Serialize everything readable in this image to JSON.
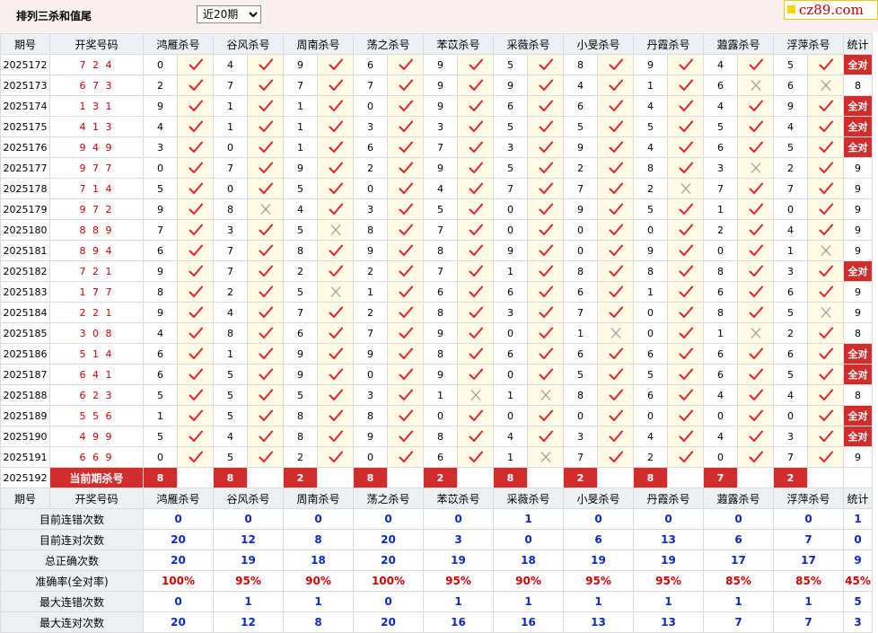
{
  "header": {
    "title": "排列三杀和值尾",
    "period_select": "近20期",
    "logo": "cz89.com"
  },
  "columns": {
    "issue": "期号",
    "code": "开奖号码",
    "stat": "统计",
    "experts": [
      "鸿雁杀号",
      "谷风杀号",
      "周南杀号",
      "荡之杀号",
      "苯苡杀号",
      "采薇杀号",
      "小旻杀号",
      "丹霞杀号",
      "蕸露杀号",
      "浮萍杀号"
    ]
  },
  "rows": [
    {
      "issue": "2025172",
      "code": "7 2 4",
      "vals": [
        "0",
        "4",
        "9",
        "6",
        "9",
        "5",
        "8",
        "9",
        "4",
        "5"
      ],
      "ok": [
        1,
        1,
        1,
        1,
        1,
        1,
        1,
        1,
        1,
        1
      ],
      "stat": "全对"
    },
    {
      "issue": "2025173",
      "code": "6 7 3",
      "vals": [
        "2",
        "7",
        "7",
        "7",
        "9",
        "9",
        "4",
        "1",
        "6",
        "6"
      ],
      "ok": [
        1,
        1,
        1,
        1,
        1,
        1,
        1,
        1,
        0,
        0
      ],
      "stat": "8"
    },
    {
      "issue": "2025174",
      "code": "1 3 1",
      "vals": [
        "9",
        "1",
        "1",
        "0",
        "9",
        "6",
        "6",
        "4",
        "4",
        "9"
      ],
      "ok": [
        1,
        1,
        1,
        1,
        1,
        1,
        1,
        1,
        1,
        1
      ],
      "stat": "全对"
    },
    {
      "issue": "2025175",
      "code": "4 1 3",
      "vals": [
        "4",
        "1",
        "1",
        "3",
        "3",
        "5",
        "5",
        "5",
        "5",
        "4"
      ],
      "ok": [
        1,
        1,
        1,
        1,
        1,
        1,
        1,
        1,
        1,
        1
      ],
      "stat": "全对"
    },
    {
      "issue": "2025176",
      "code": "9 4 9",
      "vals": [
        "3",
        "0",
        "1",
        "6",
        "7",
        "3",
        "9",
        "4",
        "6",
        "5"
      ],
      "ok": [
        1,
        1,
        1,
        1,
        1,
        1,
        1,
        1,
        1,
        1
      ],
      "stat": "全对"
    },
    {
      "issue": "2025177",
      "code": "9 7 7",
      "vals": [
        "0",
        "7",
        "9",
        "2",
        "9",
        "5",
        "2",
        "8",
        "3",
        "2"
      ],
      "ok": [
        1,
        1,
        1,
        1,
        1,
        1,
        1,
        1,
        0,
        1
      ],
      "stat": "9"
    },
    {
      "issue": "2025178",
      "code": "7 1 4",
      "vals": [
        "5",
        "0",
        "5",
        "0",
        "4",
        "7",
        "7",
        "2",
        "7",
        "7"
      ],
      "ok": [
        1,
        1,
        1,
        1,
        1,
        1,
        1,
        0,
        1,
        1
      ],
      "stat": "9"
    },
    {
      "issue": "2025179",
      "code": "9 7 2",
      "vals": [
        "9",
        "8",
        "4",
        "3",
        "5",
        "0",
        "9",
        "5",
        "1",
        "0"
      ],
      "ok": [
        1,
        0,
        1,
        1,
        1,
        1,
        1,
        1,
        1,
        1
      ],
      "stat": "9"
    },
    {
      "issue": "2025180",
      "code": "8 8 9",
      "vals": [
        "7",
        "3",
        "5",
        "8",
        "7",
        "0",
        "0",
        "0",
        "2",
        "4"
      ],
      "ok": [
        1,
        1,
        0,
        1,
        1,
        1,
        1,
        1,
        1,
        1
      ],
      "stat": "9"
    },
    {
      "issue": "2025181",
      "code": "8 9 4",
      "vals": [
        "6",
        "7",
        "8",
        "9",
        "8",
        "9",
        "0",
        "9",
        "0",
        "1"
      ],
      "ok": [
        1,
        1,
        1,
        1,
        1,
        1,
        1,
        1,
        1,
        0
      ],
      "stat": "9"
    },
    {
      "issue": "2025182",
      "code": "7 2 1",
      "vals": [
        "9",
        "7",
        "2",
        "2",
        "7",
        "1",
        "8",
        "8",
        "8",
        "3"
      ],
      "ok": [
        1,
        1,
        1,
        1,
        1,
        1,
        1,
        1,
        1,
        1
      ],
      "stat": "全对"
    },
    {
      "issue": "2025183",
      "code": "1 7 7",
      "vals": [
        "8",
        "2",
        "5",
        "1",
        "6",
        "6",
        "6",
        "1",
        "6",
        "6"
      ],
      "ok": [
        1,
        1,
        0,
        1,
        1,
        1,
        1,
        1,
        1,
        1
      ],
      "stat": "9"
    },
    {
      "issue": "2025184",
      "code": "2 2 1",
      "vals": [
        "9",
        "4",
        "7",
        "2",
        "8",
        "3",
        "7",
        "0",
        "8",
        "5"
      ],
      "ok": [
        1,
        1,
        1,
        1,
        1,
        1,
        1,
        1,
        1,
        0
      ],
      "stat": "9"
    },
    {
      "issue": "2025185",
      "code": "3 0 8",
      "vals": [
        "4",
        "8",
        "6",
        "7",
        "9",
        "0",
        "1",
        "0",
        "1",
        "2"
      ],
      "ok": [
        1,
        1,
        1,
        1,
        1,
        1,
        0,
        1,
        0,
        1
      ],
      "stat": "8"
    },
    {
      "issue": "2025186",
      "code": "5 1 4",
      "vals": [
        "6",
        "1",
        "9",
        "9",
        "8",
        "6",
        "6",
        "6",
        "6",
        "6"
      ],
      "ok": [
        1,
        1,
        1,
        1,
        1,
        1,
        1,
        1,
        1,
        1
      ],
      "stat": "全对"
    },
    {
      "issue": "2025187",
      "code": "6 4 1",
      "vals": [
        "6",
        "5",
        "9",
        "0",
        "9",
        "0",
        "5",
        "5",
        "6",
        "5"
      ],
      "ok": [
        1,
        1,
        1,
        1,
        1,
        1,
        1,
        1,
        1,
        1
      ],
      "stat": "全对"
    },
    {
      "issue": "2025188",
      "code": "6 2 3",
      "vals": [
        "5",
        "5",
        "5",
        "3",
        "1",
        "1",
        "8",
        "6",
        "4",
        "4"
      ],
      "ok": [
        1,
        1,
        1,
        1,
        0,
        0,
        1,
        1,
        1,
        1
      ],
      "stat": "8"
    },
    {
      "issue": "2025189",
      "code": "5 5 6",
      "vals": [
        "1",
        "5",
        "8",
        "8",
        "0",
        "0",
        "0",
        "0",
        "0",
        "0"
      ],
      "ok": [
        1,
        1,
        1,
        1,
        1,
        1,
        1,
        1,
        1,
        1
      ],
      "stat": "全对"
    },
    {
      "issue": "2025190",
      "code": "4 9 9",
      "vals": [
        "5",
        "4",
        "8",
        "9",
        "8",
        "4",
        "3",
        "4",
        "4",
        "3"
      ],
      "ok": [
        1,
        1,
        1,
        1,
        1,
        1,
        1,
        1,
        1,
        1
      ],
      "stat": "全对"
    },
    {
      "issue": "2025191",
      "code": "6 6 9",
      "vals": [
        "0",
        "5",
        "2",
        "0",
        "6",
        "1",
        "7",
        "2",
        "0",
        "7"
      ],
      "ok": [
        1,
        1,
        1,
        1,
        1,
        0,
        1,
        1,
        1,
        1
      ],
      "stat": "9"
    }
  ],
  "current": {
    "issue": "2025192",
    "label": "当前期杀号",
    "vals": [
      "8",
      "8",
      "2",
      "8",
      "2",
      "8",
      "2",
      "8",
      "7",
      "2"
    ]
  },
  "summary_header": {
    "issue": "期号",
    "code": "开奖号码",
    "stat": "统计"
  },
  "summary": [
    {
      "label": "目前连错次数",
      "vals": [
        "0",
        "0",
        "0",
        "0",
        "0",
        "1",
        "0",
        "0",
        "0",
        "0"
      ],
      "stat": "1",
      "acc": false
    },
    {
      "label": "目前连对次数",
      "vals": [
        "20",
        "12",
        "8",
        "20",
        "3",
        "0",
        "6",
        "13",
        "6",
        "7"
      ],
      "stat": "0",
      "acc": false
    },
    {
      "label": "总正确次数",
      "vals": [
        "20",
        "19",
        "18",
        "20",
        "19",
        "18",
        "19",
        "19",
        "17",
        "17"
      ],
      "stat": "9",
      "acc": false
    },
    {
      "label": "准确率(全对率)",
      "vals": [
        "100%",
        "95%",
        "90%",
        "100%",
        "95%",
        "90%",
        "95%",
        "95%",
        "85%",
        "85%"
      ],
      "stat": "45%",
      "acc": true
    },
    {
      "label": "最大连错次数",
      "vals": [
        "0",
        "1",
        "1",
        "0",
        "1",
        "1",
        "1",
        "1",
        "1",
        "1"
      ],
      "stat": "5",
      "acc": false
    },
    {
      "label": "最大连对次数",
      "vals": [
        "20",
        "12",
        "8",
        "20",
        "16",
        "16",
        "13",
        "13",
        "7",
        "7"
      ],
      "stat": "3",
      "acc": false
    }
  ],
  "colors": {
    "accent_red": "#d22d2d",
    "blue_value": "#0b2ac6",
    "header_bg": "#eef1f3",
    "mark_bg": "#fffbe6"
  },
  "icons": {
    "ok": "check-icon",
    "wrong": "cross-icon"
  }
}
